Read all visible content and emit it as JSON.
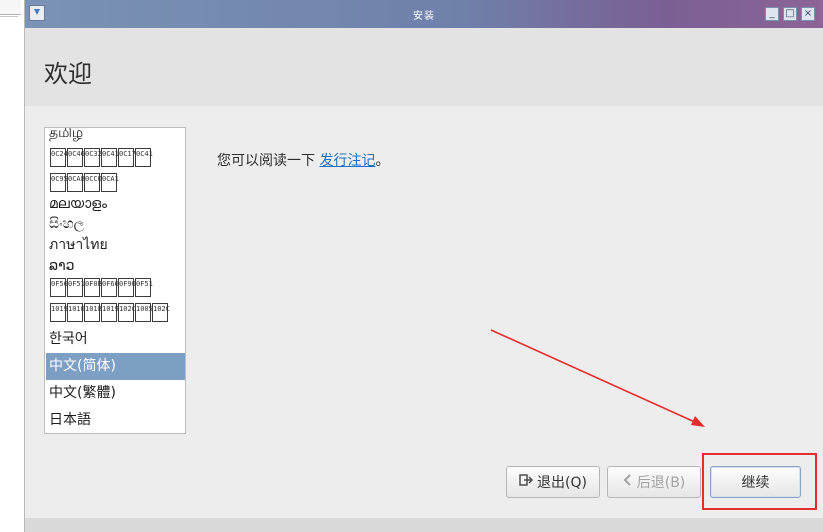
{
  "window": {
    "title": "安装",
    "controls": {
      "minimize": "_",
      "maximize": "□",
      "close": "×"
    }
  },
  "header": {
    "title": "欢迎"
  },
  "languages": {
    "items": [
      {
        "label": "தமிழ"
      },
      {
        "label": "",
        "glyph_codes": [
          "0C24",
          "0C46",
          "0C32",
          "0C41",
          "0C17",
          "0C41"
        ]
      },
      {
        "label": "",
        "glyph_codes": [
          "0C95",
          "0CA8",
          "0CCO",
          "0CA1"
        ]
      },
      {
        "label": "മലയാളം"
      },
      {
        "label": "සිංහල"
      },
      {
        "label": "ภาษาไทย"
      },
      {
        "label": "ລາວ"
      },
      {
        "label": "",
        "glyph_codes": [
          "0F56",
          "0F51",
          "0F0B",
          "0F66",
          "0F90",
          "0F51"
        ]
      },
      {
        "label": "",
        "glyph_codes": [
          "1019",
          "1010",
          "1018",
          "1019",
          "102C",
          "1005",
          "102C"
        ]
      },
      {
        "label": "한국어"
      },
      {
        "label": "中文(简体)",
        "selected": true
      },
      {
        "label": "中文(繁體)"
      },
      {
        "label": "日本語"
      }
    ]
  },
  "content": {
    "notes_prefix": "您可以阅读一下 ",
    "notes_link": "发行注记",
    "notes_suffix": "。"
  },
  "buttons": {
    "quit": {
      "label": "退出(Q)",
      "icon": "exit-icon"
    },
    "back": {
      "label": "后退(B)",
      "icon": "chevron-left-icon",
      "disabled": true
    },
    "continue": {
      "label": "继续"
    }
  },
  "annotation": {
    "color": "#e52d2d"
  }
}
